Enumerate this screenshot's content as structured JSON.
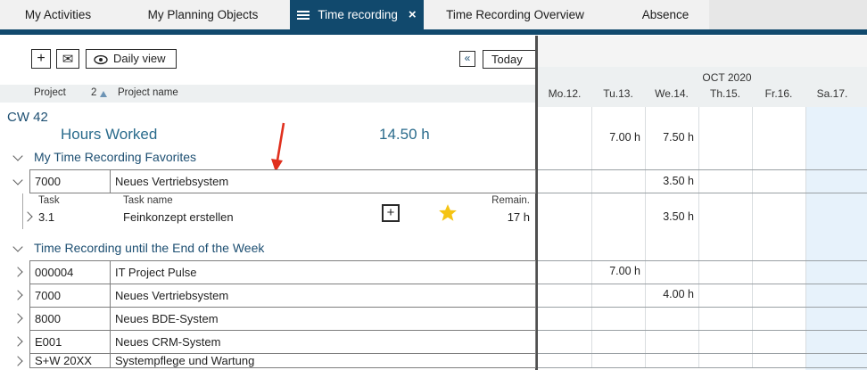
{
  "colors": {
    "accent_navy": "#11496d",
    "section_blue": "#1d4f72",
    "hours_teal": "#2a6b8c",
    "weekend_blue": "#e7f2fb",
    "star_gold": "#f5c414",
    "arrow_red": "#e0301e",
    "header_gray": "#edf0f1"
  },
  "tabs": [
    {
      "label": "My Activities"
    },
    {
      "label": "My Planning Objects"
    },
    {
      "label": "Time recording",
      "active": true,
      "close_symbol": "×"
    },
    {
      "label": "Time Recording Overview"
    },
    {
      "label": "Absence"
    }
  ],
  "toolbar": {
    "plus_symbol": "+",
    "mail_symbol": "✉",
    "daily_view_label": "Daily view",
    "prev_symbol": "«",
    "today_label": "Today"
  },
  "calendar": {
    "month": "OCT 2020",
    "days": [
      "Mo.12.",
      "Tu.13.",
      "We.14.",
      "Th.15.",
      "Fr.16.",
      "Sa.17."
    ],
    "weekend_day": "Sa.17."
  },
  "columns": {
    "project": "Project",
    "sort_badge": "2",
    "project_name": "Project name"
  },
  "week_summary": {
    "calendar_week": "CW 42",
    "hours_worked_label": "Hours Worked",
    "total": "14.50 h",
    "day_values": [
      "",
      "7.00 h",
      "7.50 h",
      "",
      "",
      ""
    ]
  },
  "favorites_section": {
    "title": "My Time Recording Favorites",
    "row": {
      "project_id": "7000",
      "project_name": "Neues Vertriebsystem",
      "day_values": [
        "",
        "",
        "3.50 h",
        "",
        "",
        ""
      ]
    },
    "task_table": {
      "headers": {
        "task": "Task",
        "task_name": "Task name",
        "remaining": "Remain."
      },
      "row": {
        "task_id": "3.1",
        "task_name": "Feinkonzept erstellen",
        "remaining": "17 h",
        "day_values": [
          "",
          "",
          "3.50 h",
          "",
          "",
          ""
        ]
      }
    }
  },
  "week_section": {
    "title": "Time Recording until the End of the Week",
    "rows": [
      {
        "project_id": "000004",
        "project_name": "IT Project Pulse",
        "day_values": [
          "",
          "7.00 h",
          "",
          "",
          "",
          ""
        ]
      },
      {
        "project_id": "7000",
        "project_name": "Neues Vertriebsystem",
        "day_values": [
          "",
          "",
          "4.00 h",
          "",
          "",
          ""
        ]
      },
      {
        "project_id": "8000",
        "project_name": "Neues BDE-System",
        "day_values": [
          "",
          "",
          "",
          "",
          "",
          ""
        ]
      },
      {
        "project_id": "E001",
        "project_name": "Neues CRM-System",
        "day_values": [
          "",
          "",
          "",
          "",
          "",
          ""
        ]
      },
      {
        "project_id": "S+W 20XX",
        "project_name": "Systempflege und Wartung",
        "day_values": [
          "",
          "",
          "",
          "",
          "",
          ""
        ]
      }
    ]
  }
}
